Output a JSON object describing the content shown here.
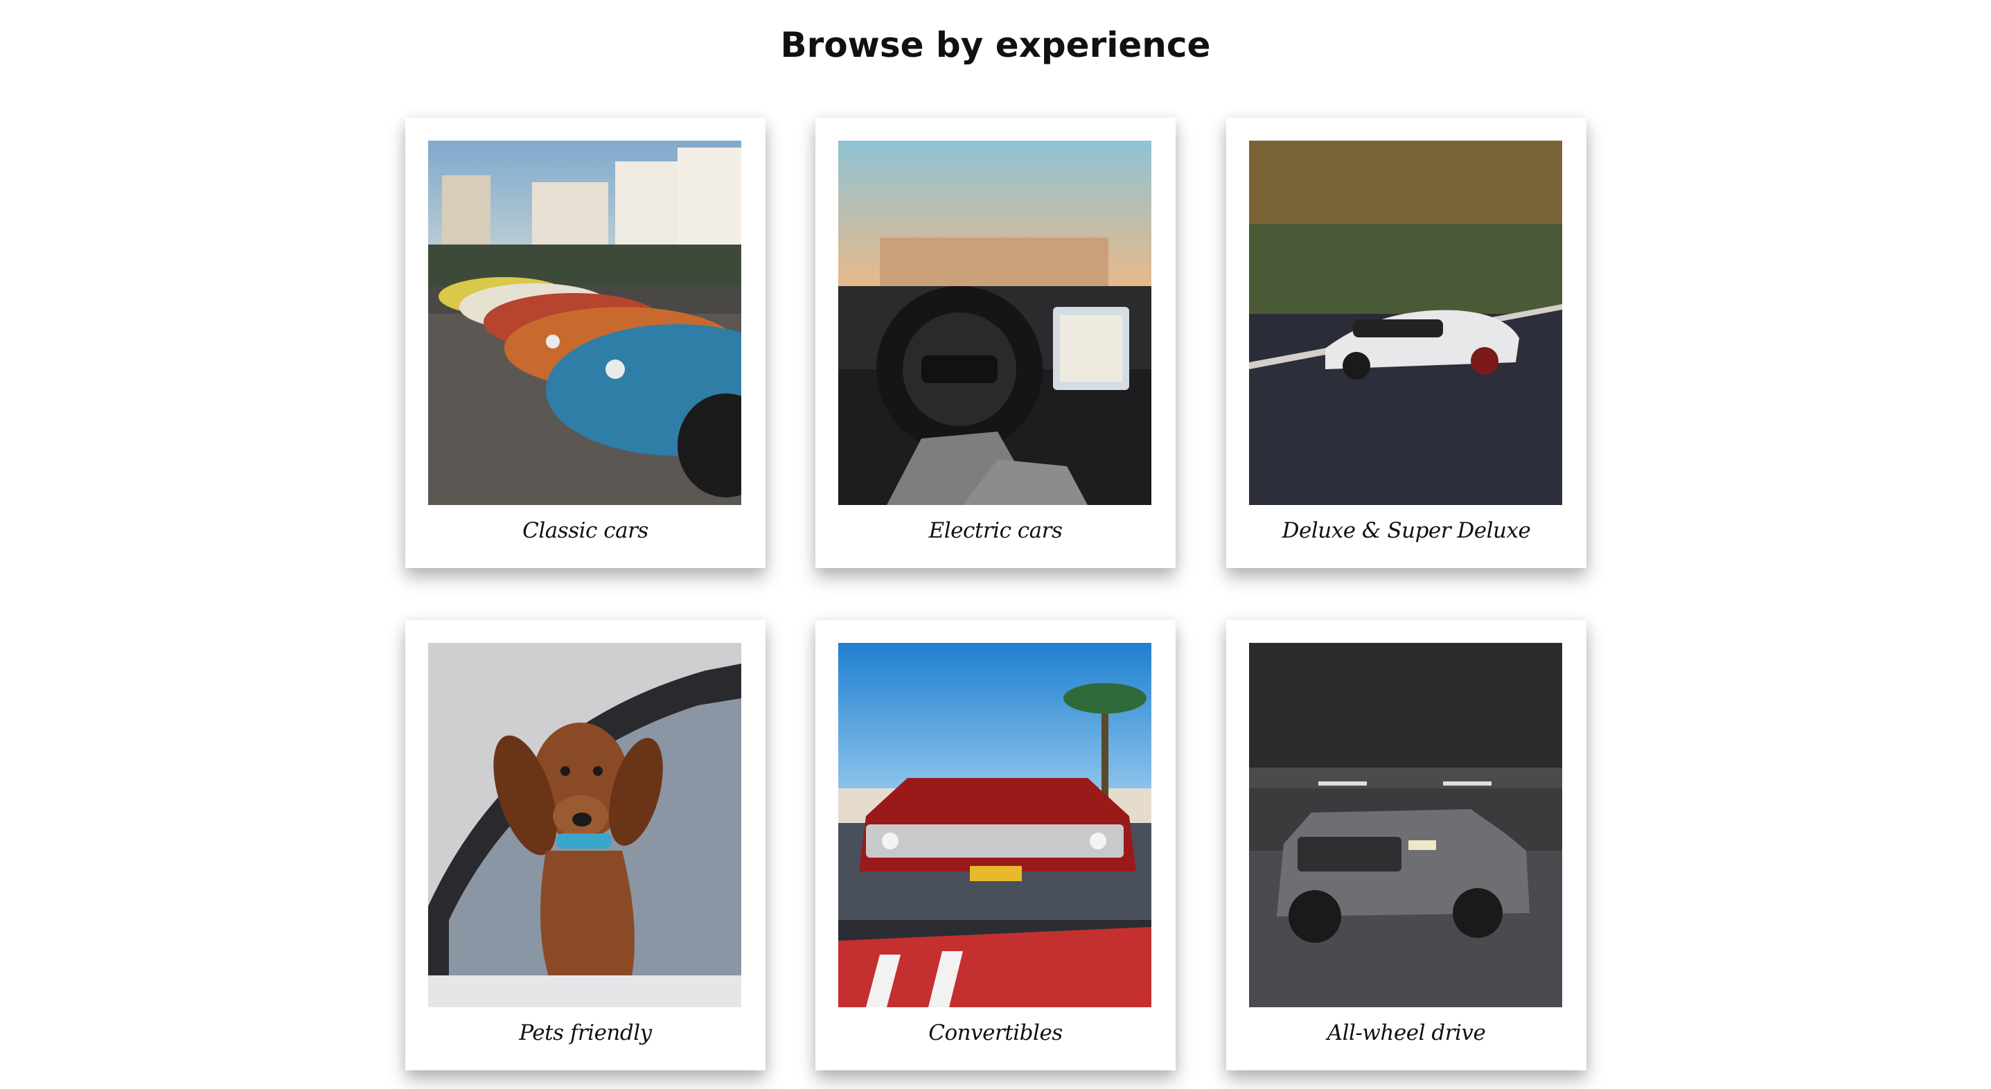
{
  "page": {
    "heading": "Browse by experience"
  },
  "cards": [
    {
      "label": "Classic cars",
      "icon": "classic-cars-photo"
    },
    {
      "label": "Electric cars",
      "icon": "electric-cars-photo"
    },
    {
      "label": "Deluxe & Super Deluxe",
      "icon": "deluxe-cars-photo"
    },
    {
      "label": "Pets friendly",
      "icon": "pets-friendly-photo"
    },
    {
      "label": "Convertibles",
      "icon": "convertibles-photo"
    },
    {
      "label": "All-wheel drive",
      "icon": "all-wheel-drive-photo"
    }
  ]
}
